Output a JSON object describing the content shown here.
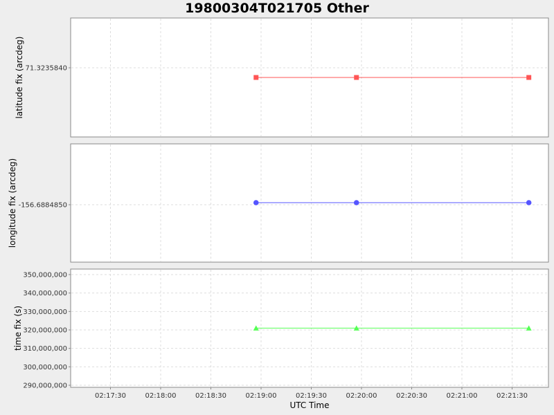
{
  "title": "19800304T021705 Other",
  "colors": {
    "background": "#eeeeee",
    "plot_background": "#ffffff",
    "grid": "#dddddd",
    "axis": "#888888",
    "series_lat": "#ff5555",
    "series_lon": "#5555ff",
    "series_time": "#55ff55"
  },
  "chart_data": {
    "type": "line",
    "title": "19800304T021705 Other",
    "xlabel": "UTC Time",
    "x_axis": {
      "range": [
        "02:17:07",
        "02:21:57"
      ],
      "ticks": [
        "02:17:30",
        "02:18:00",
        "02:18:30",
        "02:19:00",
        "02:19:30",
        "02:20:00",
        "02:20:30",
        "02:21:00",
        "02:21:30"
      ],
      "tick_labels": [
        "02:17:30",
        "02:18:00",
        "02:18:30",
        "02:19:00",
        "02:19:30",
        "02:20:00",
        "02:20:30",
        "02:21:00",
        "02:21:30"
      ]
    },
    "grid": true,
    "x": [
      "02:18:57",
      "02:19:57",
      "02:21:40"
    ],
    "panels": [
      {
        "ylabel": "latitude fix (arcdeg)",
        "ticks": [
          71.323584
        ],
        "tick_labels": [
          "71.3235840"
        ],
        "series": [
          {
            "values": [
              71.323583,
              71.323583,
              71.323583
            ],
            "marker": "square",
            "color": "#ff5555"
          }
        ]
      },
      {
        "ylabel": "longitude fix (arcdeg)",
        "ticks": [
          -156.688485
        ],
        "tick_labels": [
          "-156.6884850"
        ],
        "series": [
          {
            "values": [
              -156.6884849,
              -156.6884849,
              -156.6884849
            ],
            "marker": "circle",
            "color": "#5555ff"
          }
        ]
      },
      {
        "ylabel": "time fix (s)",
        "ylim": [
          289000000,
          352000000
        ],
        "ticks": [
          290000000,
          300000000,
          310000000,
          320000000,
          330000000,
          340000000,
          350000000
        ],
        "tick_labels": [
          "290,000,000",
          "300,000,000",
          "310,000,000",
          "320,000,000",
          "330,000,000",
          "340,000,000",
          "350,000,000"
        ],
        "series": [
          {
            "values": [
              321000000,
              321000000,
              321000000
            ],
            "marker": "triangle",
            "color": "#55ff55"
          }
        ]
      }
    ]
  }
}
